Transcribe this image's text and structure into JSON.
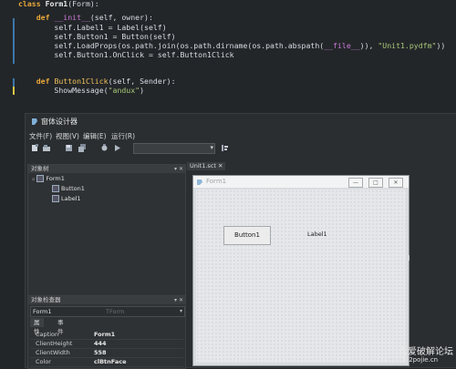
{
  "editor": {
    "lines": [
      {
        "parts": [
          {
            "t": "class ",
            "c": "kw"
          },
          {
            "t": "Form1",
            "c": "cls"
          },
          {
            "t": "(Form):",
            "c": ""
          }
        ]
      },
      {
        "parts": []
      },
      {
        "parts": [
          {
            "t": "    def ",
            "c": "kw"
          },
          {
            "t": "__init__",
            "c": "mag"
          },
          {
            "t": "(self, owner):",
            "c": ""
          }
        ]
      },
      {
        "parts": [
          {
            "t": "        self.Label1 = Label(self)",
            "c": ""
          }
        ]
      },
      {
        "parts": [
          {
            "t": "        self.Button1 = Button(self)",
            "c": ""
          }
        ]
      },
      {
        "parts": [
          {
            "t": "        self.LoadProps(os.path.join(os.path.dirname(os.path.abspath(",
            "c": ""
          },
          {
            "t": "__file__",
            "c": "mag"
          },
          {
            "t": ")), ",
            "c": ""
          },
          {
            "t": "\"Unit1.pydfm\"",
            "c": "str"
          },
          {
            "t": "))",
            "c": ""
          }
        ]
      },
      {
        "parts": [
          {
            "t": "        self.Button1.OnClick = self.Button1Click",
            "c": ""
          }
        ]
      },
      {
        "parts": []
      },
      {
        "parts": [
          {
            "t": "    def ",
            "c": "kw"
          },
          {
            "t": "Button1Click",
            "c": "fn"
          },
          {
            "t": "(self, Sender):",
            "c": ""
          }
        ]
      },
      {
        "parts": [
          {
            "t": "        ShowMessage(",
            "c": ""
          },
          {
            "t": "\"andux\"",
            "c": "str"
          },
          {
            "t": ")",
            "c": ""
          }
        ]
      }
    ]
  },
  "designer": {
    "title": "窗体设计器",
    "menu": [
      "文件(F)",
      "视图(V)",
      "编辑(E)",
      "运行(R)"
    ],
    "tree_panel": {
      "title": "对象树",
      "items": [
        "Form1",
        "Button1",
        "Label1"
      ]
    },
    "inspector": {
      "title": "对象检查器",
      "selected": "Form1",
      "selected_type": "TForm",
      "tabs": [
        "属性",
        "事件"
      ],
      "props": [
        {
          "name": "Caption",
          "value": "Form1"
        },
        {
          "name": "ClientHeight",
          "value": "444"
        },
        {
          "name": "ClientWidth",
          "value": "558"
        },
        {
          "name": "Color",
          "value": "clBtnFace"
        }
      ]
    },
    "doc_tab": "Unit1.sct",
    "form": {
      "title": "Form1",
      "button_label": "Button1",
      "label_text": "Label1",
      "win_buttons": [
        "—",
        "□",
        "✕"
      ]
    }
  },
  "watermark": {
    "line1": "吾爱破解论坛",
    "line2": "www.52pojie.cn"
  },
  "colors": {
    "accent": "#3b77a8",
    "keyword": "#e8a83a",
    "string": "#a8c878",
    "magic": "#c97ad8"
  }
}
